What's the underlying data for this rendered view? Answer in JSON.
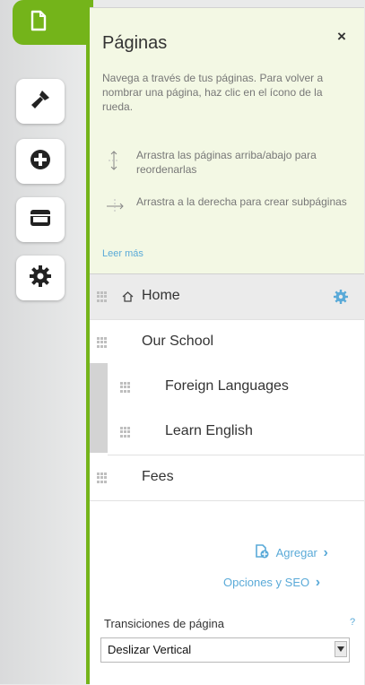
{
  "sidebar": {
    "items": [
      {
        "icon": "page-icon",
        "active": true
      },
      {
        "icon": "brush-icon",
        "active": false
      },
      {
        "icon": "add-icon",
        "active": false
      },
      {
        "icon": "store-icon",
        "active": false
      },
      {
        "icon": "gear-icon",
        "active": false
      }
    ]
  },
  "panel": {
    "title": "Páginas",
    "close_label": "×",
    "description": "Navega a través de tus páginas. Para volver a nombrar una página, haz clic en el ícono de la rueda.",
    "tips": [
      {
        "icon": "drag-vertical-icon",
        "text": "Arrastra las páginas arriba/abajo para reordenarlas"
      },
      {
        "icon": "drag-horizontal-icon",
        "text": "Arrastra a la derecha para crear subpáginas"
      }
    ],
    "read_more": "Leer más"
  },
  "pages": [
    {
      "label": "Home",
      "level": 0,
      "selected": true,
      "home": true
    },
    {
      "label": "Our School",
      "level": 0,
      "selected": false
    },
    {
      "label": "Foreign Languages",
      "level": 1,
      "selected": false
    },
    {
      "label": "Learn English",
      "level": 1,
      "selected": false
    },
    {
      "label": "Fees",
      "level": 0,
      "selected": false
    }
  ],
  "actions": {
    "add_label": "Agregar",
    "add_chevron": "›",
    "seo_label": "Opciones y SEO",
    "seo_chevron": "›"
  },
  "transitions": {
    "label": "Transiciones de página",
    "help": "?",
    "selected": "Deslizar Vertical"
  },
  "colors": {
    "accent": "#74b41a",
    "link": "#5aaad8",
    "help_bg": "#f3f8e4"
  }
}
